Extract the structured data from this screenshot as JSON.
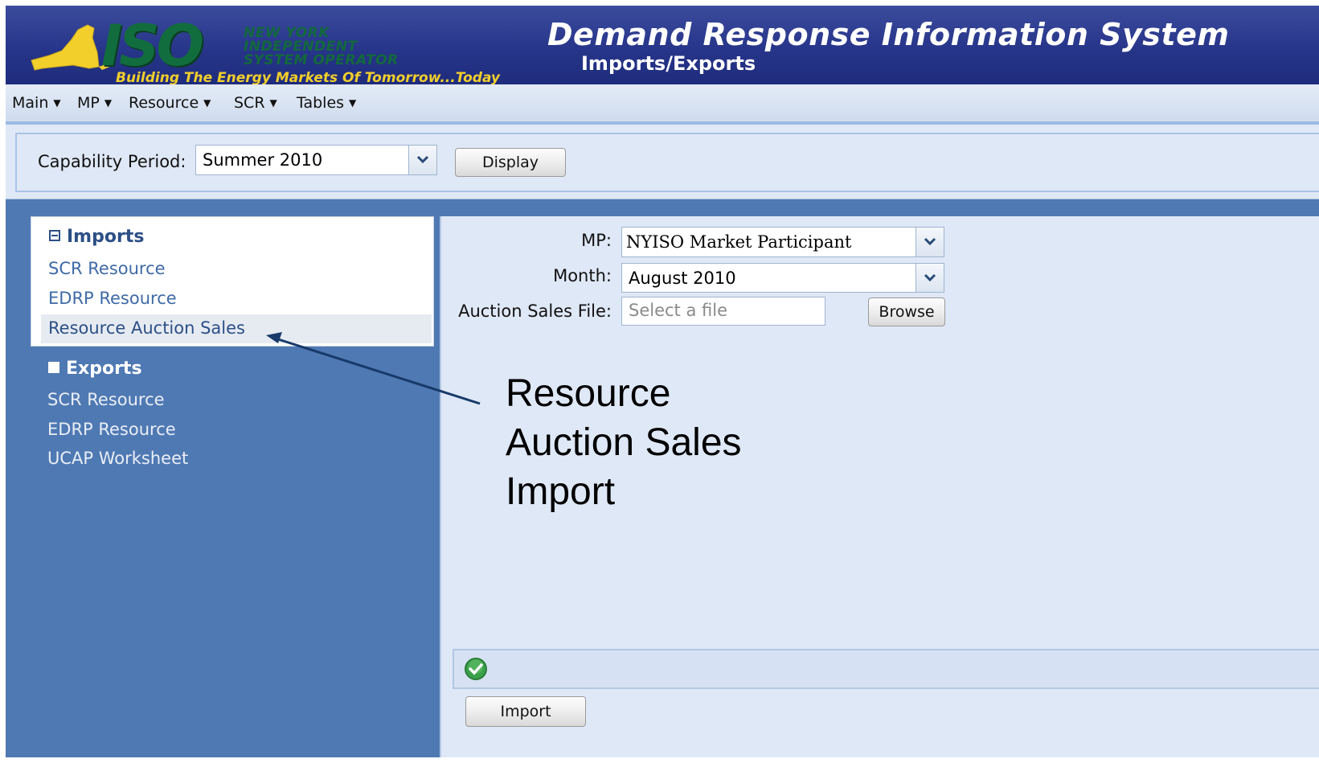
{
  "header": {
    "logo_text": "ISO",
    "org_lines": [
      "NEW YORK",
      "INDEPENDENT",
      "SYSTEM OPERATOR"
    ],
    "tagline": "Building The Energy Markets Of Tomorrow...Today",
    "app_title": "Demand Response Information System",
    "page_subtitle": "Imports/Exports"
  },
  "menu": {
    "items": [
      {
        "label": "Main"
      },
      {
        "label": "MP"
      },
      {
        "label": "Resource"
      },
      {
        "label": "SCR"
      },
      {
        "label": "Tables"
      }
    ]
  },
  "capability": {
    "label": "Capability Period:",
    "value": "Summer 2010",
    "display_button": "Display"
  },
  "nav": {
    "imports": {
      "title": "Imports",
      "items": [
        {
          "label": "SCR Resource"
        },
        {
          "label": "EDRP Resource"
        },
        {
          "label": "Resource Auction Sales"
        }
      ]
    },
    "exports": {
      "title": "Exports",
      "items": [
        {
          "label": "SCR Resource"
        },
        {
          "label": "EDRP Resource"
        },
        {
          "label": "UCAP Worksheet"
        }
      ]
    }
  },
  "form": {
    "mp_label": "MP:",
    "mp_value": "NYISO Market Participant",
    "month_label": "Month:",
    "month_value": "August 2010",
    "file_label": "Auction Sales File:",
    "file_placeholder": "Select a file",
    "browse_button": "Browse",
    "import_button": "Import"
  },
  "annotation": {
    "lines": [
      "Resource",
      "Auction Sales",
      "Import"
    ]
  },
  "colors": {
    "header_bg": "#27358a",
    "nav_bg": "#4f79b3",
    "panel_bg": "#dfe8f6",
    "link_selected": "#2c4f86",
    "status_ok": "#3aa14a",
    "arrow": "#173a6a"
  },
  "icons": {
    "status": "check-circle-icon",
    "dropdown": "chevron-down-icon",
    "logo_state": "new-york-state-icon"
  }
}
